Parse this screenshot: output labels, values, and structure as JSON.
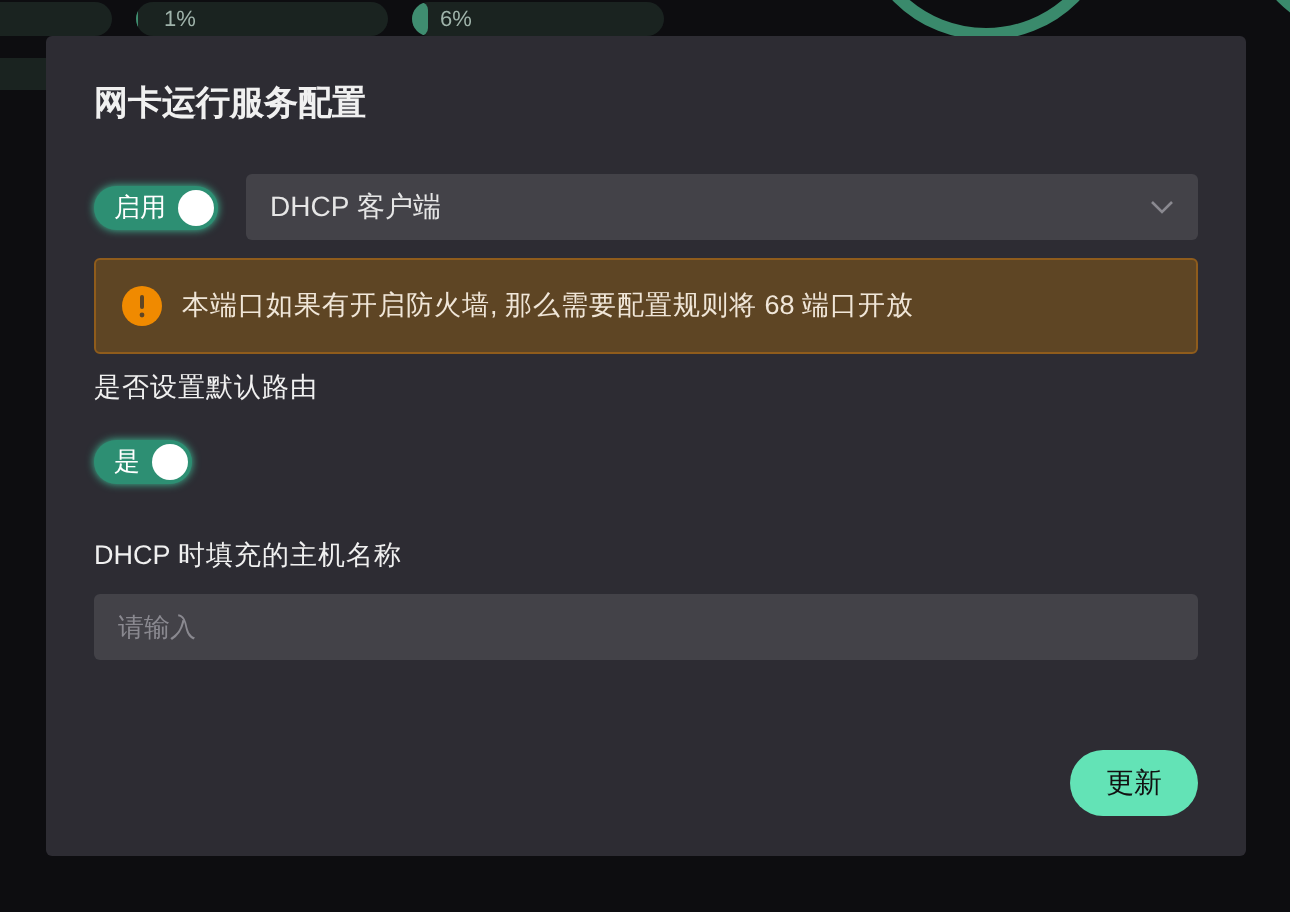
{
  "background": {
    "meters": [
      {
        "label": "1%",
        "level": 0.01
      },
      {
        "label": "6%",
        "level": 0.06
      }
    ]
  },
  "dialog": {
    "title": "网卡运行服务配置",
    "enable_switch": {
      "label": "启用",
      "on": true
    },
    "mode_select": {
      "value": "DHCP 客户端"
    },
    "alert": {
      "text": "本端口如果有开启防火墙, 那么需要配置规则将 68 端口开放"
    },
    "default_route": {
      "label": "是否设置默认路由",
      "switch": {
        "label": "是",
        "on": true
      }
    },
    "hostname": {
      "label": "DHCP 时填充的主机名称",
      "placeholder": "请输入"
    },
    "submit_button": "更新"
  }
}
